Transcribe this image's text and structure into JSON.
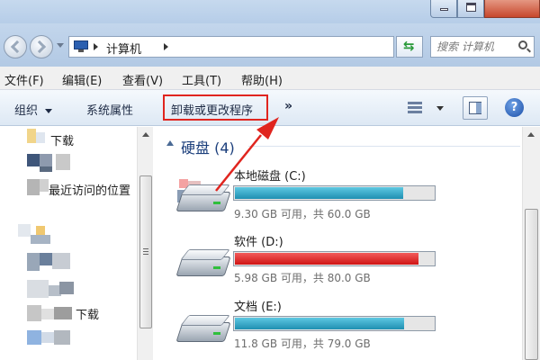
{
  "address": {
    "breadcrumb": "计算机",
    "search_placeholder": "搜索 计算机"
  },
  "menu": {
    "file": "文件(F)",
    "edit": "编辑(E)",
    "view": "查看(V)",
    "tools": "工具(T)",
    "help": "帮助(H)"
  },
  "toolbar": {
    "organize": "组织",
    "system_properties": "系统属性",
    "uninstall": "卸载或更改程序",
    "more": "»"
  },
  "nav": {
    "items": [
      {
        "label": "下载"
      },
      {
        "label": "最近访问的位置"
      },
      {
        "label": "下载"
      }
    ]
  },
  "content": {
    "group_title": "硬盘 (4)",
    "drives": [
      {
        "name": "本地磁盘 (C:)",
        "info": "9.30 GB 可用，共 60.0 GB",
        "used_fraction": 0.845,
        "bar_color": "blue"
      },
      {
        "name": "软件 (D:)",
        "info": "5.98 GB 可用，共 80.0 GB",
        "used_fraction": 0.925,
        "bar_color": "red"
      },
      {
        "name": "文档 (E:)",
        "info": "11.8 GB 可用，共 79.0 GB",
        "used_fraction": 0.85,
        "bar_color": "blue"
      }
    ]
  },
  "colors": {
    "highlight": "#e0251f",
    "bar_blue": "#1f8fb1",
    "bar_red": "#cf1515"
  }
}
